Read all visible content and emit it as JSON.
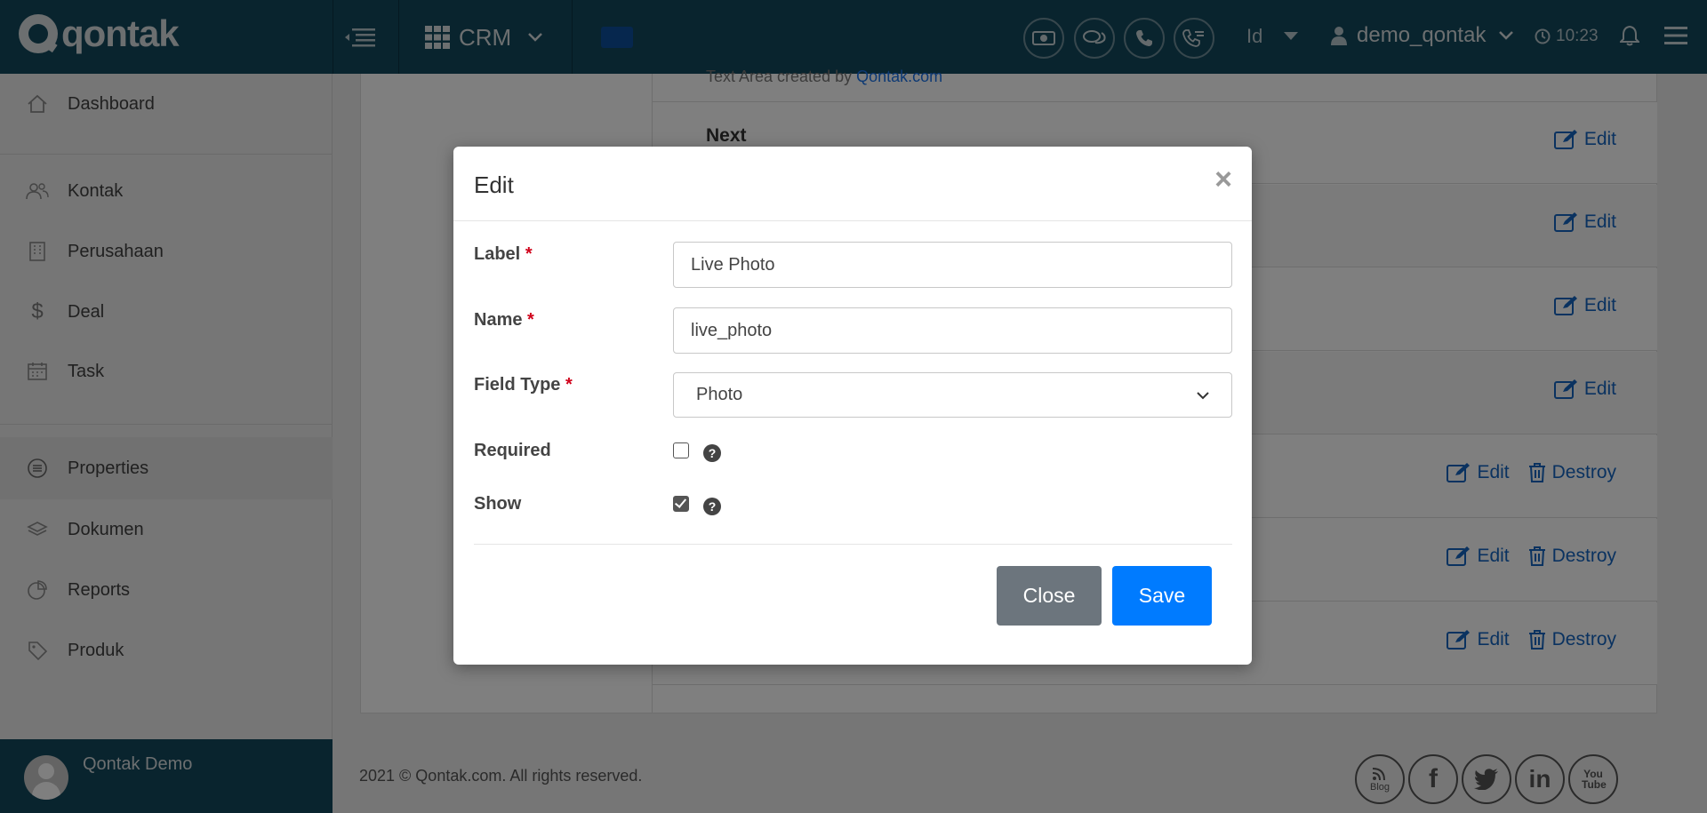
{
  "topbar": {
    "logo_text": "qontak",
    "app_name": "CRM",
    "language": "Id",
    "username": "demo_qontak",
    "time": "10:23"
  },
  "sidebar": {
    "items": [
      {
        "label": "Dashboard",
        "icon": "home-icon"
      },
      {
        "label": "Kontak",
        "icon": "users-icon"
      },
      {
        "label": "Perusahaan",
        "icon": "building-icon"
      },
      {
        "label": "Deal",
        "icon": "dollar-icon"
      },
      {
        "label": "Task",
        "icon": "calendar-icon"
      },
      {
        "label": "Properties",
        "icon": "list-icon"
      },
      {
        "label": "Dokumen",
        "icon": "layers-icon"
      },
      {
        "label": "Reports",
        "icon": "pie-chart-icon"
      },
      {
        "label": "Produk",
        "icon": "tag-icon"
      }
    ],
    "user_name": "Qontak Demo"
  },
  "content": {
    "top_sub_prefix": "Text Area created by ",
    "top_sub_link": "Qontak.com",
    "rows": [
      {
        "title": "Next",
        "actions": [
          "Edit"
        ]
      },
      {
        "actions": [
          "Edit"
        ]
      },
      {
        "actions": [
          "Edit"
        ]
      },
      {
        "actions": [
          "Edit"
        ]
      },
      {
        "actions": [
          "Edit",
          "Destroy"
        ]
      },
      {
        "actions": [
          "Edit",
          "Destroy"
        ]
      },
      {
        "actions": [
          "Edit",
          "Destroy"
        ]
      }
    ]
  },
  "footer": {
    "copyright": "2021 © Qontak.com. All rights reserved.",
    "social": [
      "Blog",
      "f",
      "twitter",
      "in",
      "You Tube"
    ]
  },
  "modal": {
    "title": "Edit",
    "close_symbol": "×",
    "fields": {
      "label": {
        "label": "Label",
        "required_mark": "*",
        "value": "Live Photo"
      },
      "name": {
        "label": "Name",
        "required_mark": "*",
        "value": "live_photo"
      },
      "field_type": {
        "label": "Field Type",
        "required_mark": "*",
        "value": "Photo"
      },
      "required": {
        "label": "Required",
        "checked": false
      },
      "show": {
        "label": "Show",
        "checked": true
      }
    },
    "help_symbol": "?",
    "close_button": "Close",
    "save_button": "Save"
  },
  "colors": {
    "topbar": "#12485c",
    "primary": "#007bff",
    "secondary": "#6c757d",
    "link": "#1565c0",
    "required": "#d0021b"
  }
}
